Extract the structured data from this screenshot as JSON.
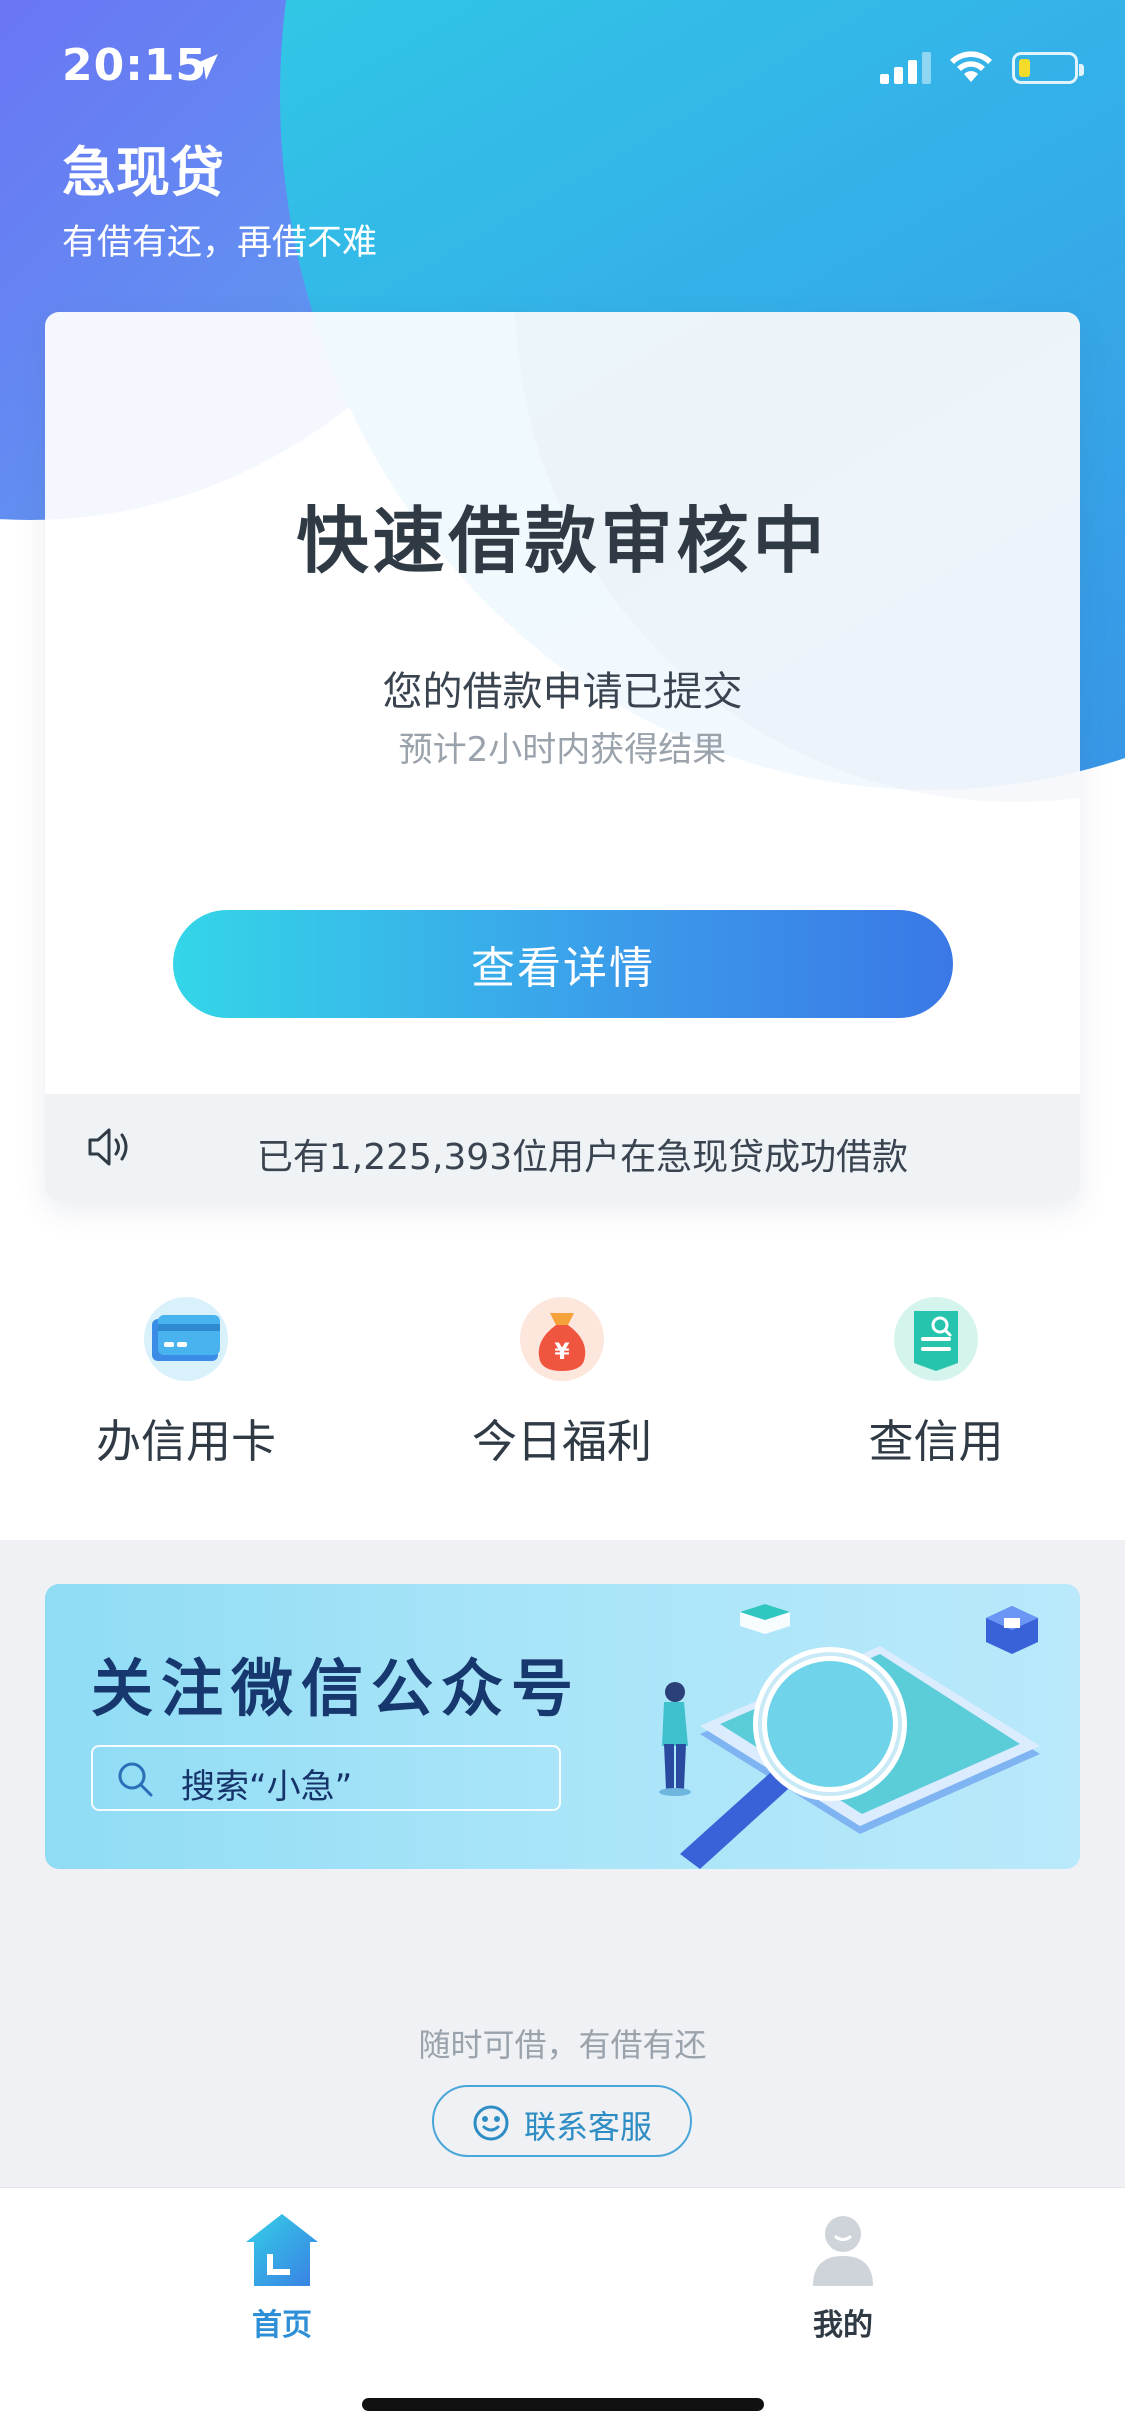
{
  "status_bar": {
    "time": "20:15",
    "battery_level": 0.2,
    "battery_color": "#f5dc2a"
  },
  "header": {
    "app_name": "急现贷",
    "slogan": "有借有还，再借不难"
  },
  "loan_card": {
    "title": "快速借款审核中",
    "message": "您的借款申请已提交",
    "note": "预计2小时内获得结果",
    "button_label": "查看详情",
    "ticker_icon": "speaker-icon",
    "ticker_text": "已有1,225,393位用户在急现贷成功借款"
  },
  "quick_entries": [
    {
      "label": "办信用卡",
      "icon": "credit-card-icon"
    },
    {
      "label": "今日福利",
      "icon": "money-bag-icon"
    },
    {
      "label": "查信用",
      "icon": "credit-report-icon"
    }
  ],
  "banner": {
    "title": "关注微信公众号",
    "search_text": "搜索“小急”",
    "search_icon": "search-icon"
  },
  "footer": {
    "tagline": "随时可借，有借有还",
    "service_label": "联系客服",
    "service_icon": "smile-icon"
  },
  "tabbar": {
    "items": [
      {
        "label": "首页",
        "icon": "home-icon",
        "active": true
      },
      {
        "label": "我的",
        "icon": "user-icon",
        "active": false
      }
    ],
    "active_color": "#2f8fd6"
  },
  "colors": {
    "accent": "#3b99ea",
    "banner_title": "#17386e"
  }
}
